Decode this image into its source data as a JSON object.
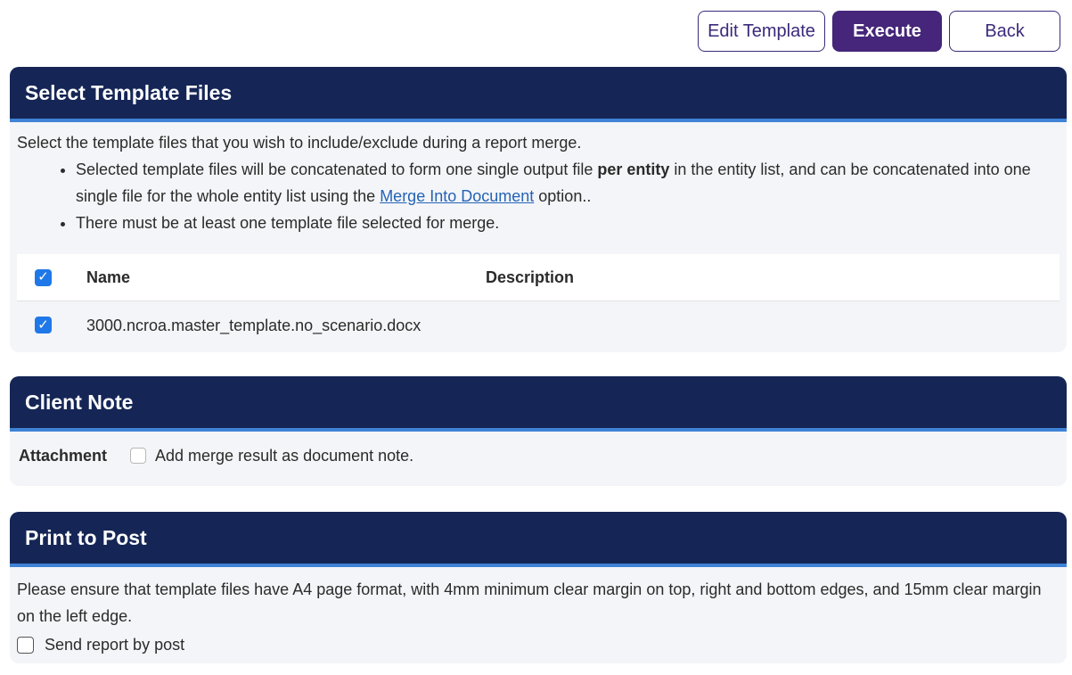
{
  "toolbar": {
    "edit_template_label": "Edit Template",
    "execute_label": "Execute",
    "back_label": "Back"
  },
  "select_template": {
    "title": "Select Template Files",
    "intro": "Select the template files that you wish to include/exclude during a report merge.",
    "bullet1_pre": "Selected template files will be concatenated to form one single output file ",
    "bullet1_bold": "per entity",
    "bullet1_mid": " in the entity list, and can be concatenated into one single file for the whole entity list using the ",
    "bullet1_link": "Merge Into Document",
    "bullet1_post": " option..",
    "bullet2": "There must be at least one template file selected for merge.",
    "table": {
      "columns": [
        "Name",
        "Description"
      ],
      "select_all_checked": true,
      "rows": [
        {
          "checked": true,
          "name": "3000.ncroa.master_template.no_scenario.docx",
          "description": ""
        }
      ]
    }
  },
  "client_note": {
    "title": "Client Note",
    "attachment_label": "Attachment",
    "checkbox_label": "Add merge result as document note.",
    "checked": false
  },
  "print_to_post": {
    "title": "Print to Post",
    "description": "Please ensure that template files have A4 page format, with 4mm minimum clear margin on top, right and bottom edges, and 15mm clear margin on the left edge.",
    "checkbox_label": "Send report by post",
    "checked": false
  },
  "icons": {
    "checkbox_checked": "checkmark-icon"
  },
  "colors": {
    "header_bg": "#152656",
    "header_accent": "#3f83d6",
    "primary_button": "#45267a",
    "link": "#2463b6",
    "checkbox_checked": "#1f78e8"
  }
}
